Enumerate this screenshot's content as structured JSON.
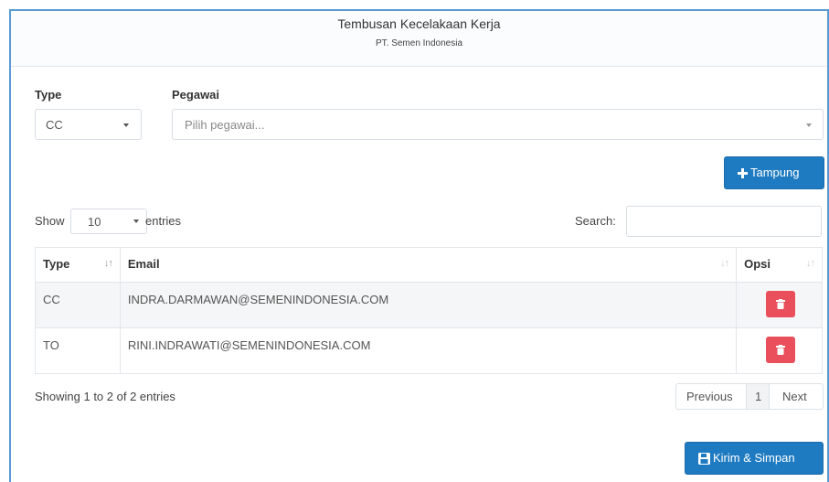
{
  "header": {
    "title": "Tembusan Kecelakaan Kerja",
    "subtitle": "PT. Semen Indonesia"
  },
  "form": {
    "type_label": "Type",
    "type_value": "CC",
    "pegawai_label": "Pegawai",
    "pegawai_placeholder": "Pilih pegawai..."
  },
  "tampung_button": {
    "icon": "plus-icon",
    "label": "Tampung"
  },
  "table_controls": {
    "show_label": "Show",
    "entries_value": "10",
    "entries_label": "entries",
    "search_label": "Search:",
    "search_value": ""
  },
  "table": {
    "columns": [
      "Type",
      "Email",
      "Opsi"
    ],
    "rows": [
      {
        "type": "CC",
        "email": "INDRA.DARMAWAN@SEMENINDONESIA.COM",
        "action": "trash-icon"
      },
      {
        "type": "TO",
        "email": "RINI.INDRAWATI@SEMENINDONESIA.COM",
        "action": "trash-icon"
      }
    ]
  },
  "footer": {
    "info": "Showing 1 to 2 of 2 entries",
    "pagination": {
      "previous": "Previous",
      "current_page": "1",
      "next": "Next"
    }
  },
  "submit_button": {
    "icon": "save-icon",
    "label": "Kirim & Simpan"
  },
  "colors": {
    "primary": "#1f7bc1",
    "danger": "#ea4f5c",
    "frame_border": "#5b9bd5"
  }
}
